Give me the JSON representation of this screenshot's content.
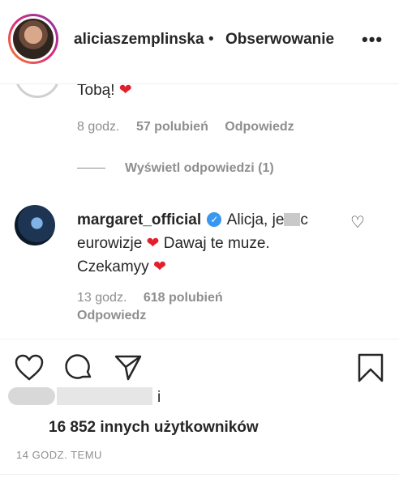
{
  "header": {
    "username": "aliciaszemplinska",
    "separator": "•",
    "follow_label": "Obserwowanie",
    "more": "•••"
  },
  "comment_prev": {
    "text": "Tobą!",
    "time": "8 godz.",
    "likes": "57 polubień",
    "reply": "Odpowiedz",
    "view_replies": "Wyświetl odpowiedzi (1)"
  },
  "comment_main": {
    "username": "margaret_official",
    "text_a": "Alicja, je",
    "text_b": "c eurowizje",
    "text_c": "Dawaj te muze. Czekamyy",
    "time": "13 godz.",
    "likes": "618 polubień",
    "reply": "Odpowiedz"
  },
  "actions": {
    "like_icon": "heart-icon",
    "comment_icon": "comment-icon",
    "share_icon": "send-icon",
    "save_icon": "bookmark-icon"
  },
  "likes_summary": {
    "connector": "i",
    "count_text": "16 852 innych użytkowników"
  },
  "timestamp": "14 GODZ. TEMU"
}
